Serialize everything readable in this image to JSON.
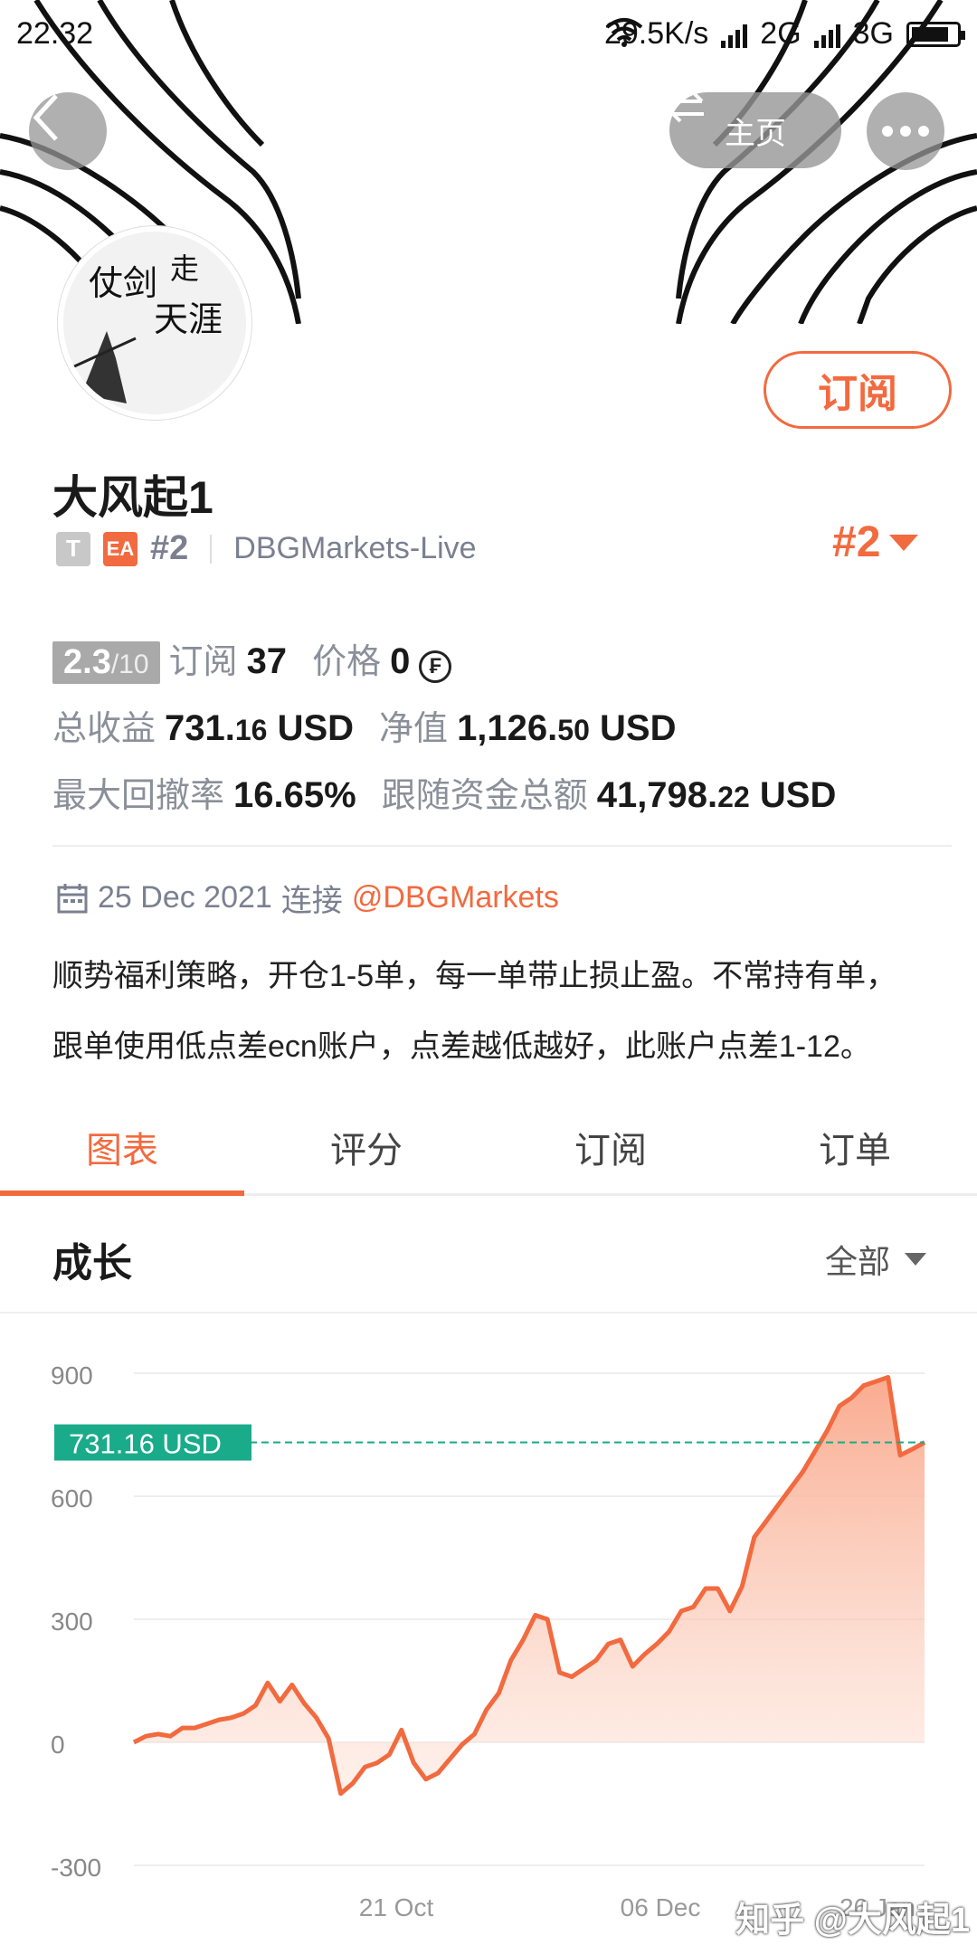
{
  "status_bar": {
    "time": "22:32",
    "net_speed": "29.5K/s",
    "network_1": "2G",
    "network_2": "3G"
  },
  "header": {
    "home_label": "主页",
    "icons": [
      "back-chevron-icon",
      "swap-arrows-icon",
      "more-dots-icon",
      "wifi-icon",
      "battery-icon"
    ]
  },
  "profile": {
    "avatar_text": [
      "仗剑",
      "走",
      "天涯"
    ],
    "subscribe_label": "订阅",
    "name": "大风起1",
    "tag_t": "T",
    "tag_ea": "EA",
    "rank_small": "#2",
    "broker": "DBGMarkets-Live",
    "rank_big": "#2"
  },
  "stats": {
    "score": "2.3",
    "score_max": "/10",
    "subs_label": "订阅",
    "subs_value": "37",
    "price_label": "价格",
    "price_value": "0",
    "price_icon": "₣",
    "total_profit_label": "总收益",
    "total_profit_main": "731.",
    "total_profit_dec": "16",
    "total_profit_unit": "USD",
    "equity_label": "净值",
    "equity_main": "1,126.",
    "equity_dec": "50",
    "equity_unit": "USD",
    "drawdown_label": "最大回撤率",
    "drawdown_value": "16.65%",
    "follow_label": "跟随资金总额",
    "follow_main": "41,798.",
    "follow_dec": "22",
    "follow_unit": "USD"
  },
  "connection": {
    "date": "25 Dec 2021",
    "label": "连接",
    "mention": "@DBGMarkets"
  },
  "description": {
    "line1": "顺势福利策略，开仓1-5单，每一单带止损止盈。不常持有单，",
    "line2": "跟单使用低点差ecn账户，点差越低越好，此账户点差1-12。"
  },
  "tabs": [
    {
      "label": "图表",
      "active": true
    },
    {
      "label": "评分",
      "active": false
    },
    {
      "label": "订阅",
      "active": false
    },
    {
      "label": "订单",
      "active": false
    }
  ],
  "section": {
    "title": "成长",
    "range_label": "全部"
  },
  "colors": {
    "accent": "#f26a3f",
    "current_value_badge": "#1aab8a",
    "muted_text": "#7a8090"
  },
  "chart_data": {
    "type": "area",
    "title": "成长",
    "y_ticks": [
      900,
      600,
      300,
      0,
      -300
    ],
    "ylim": [
      -300,
      900
    ],
    "x_tick_labels": [
      "21 Oct",
      "06 Dec",
      "26 Jan"
    ],
    "current_value_label": "731.16 USD",
    "current_value": 731.16,
    "grid": true,
    "series": [
      {
        "values": [
          0,
          15,
          20,
          15,
          35,
          35,
          45,
          55,
          60,
          70,
          90,
          145,
          100,
          140,
          95,
          60,
          10,
          -125,
          -100,
          -60,
          -50,
          -30,
          30,
          -50,
          -90,
          -75,
          -40,
          -5,
          20,
          80,
          120,
          200,
          250,
          310,
          300,
          170,
          160,
          180,
          200,
          240,
          250,
          185,
          215,
          240,
          270,
          320,
          330,
          375,
          375,
          320,
          380,
          500,
          540,
          580,
          620,
          660,
          710,
          760,
          820,
          840,
          870,
          880,
          890,
          700,
          715,
          731.16
        ]
      }
    ]
  },
  "watermark": "知乎 @大风起1"
}
